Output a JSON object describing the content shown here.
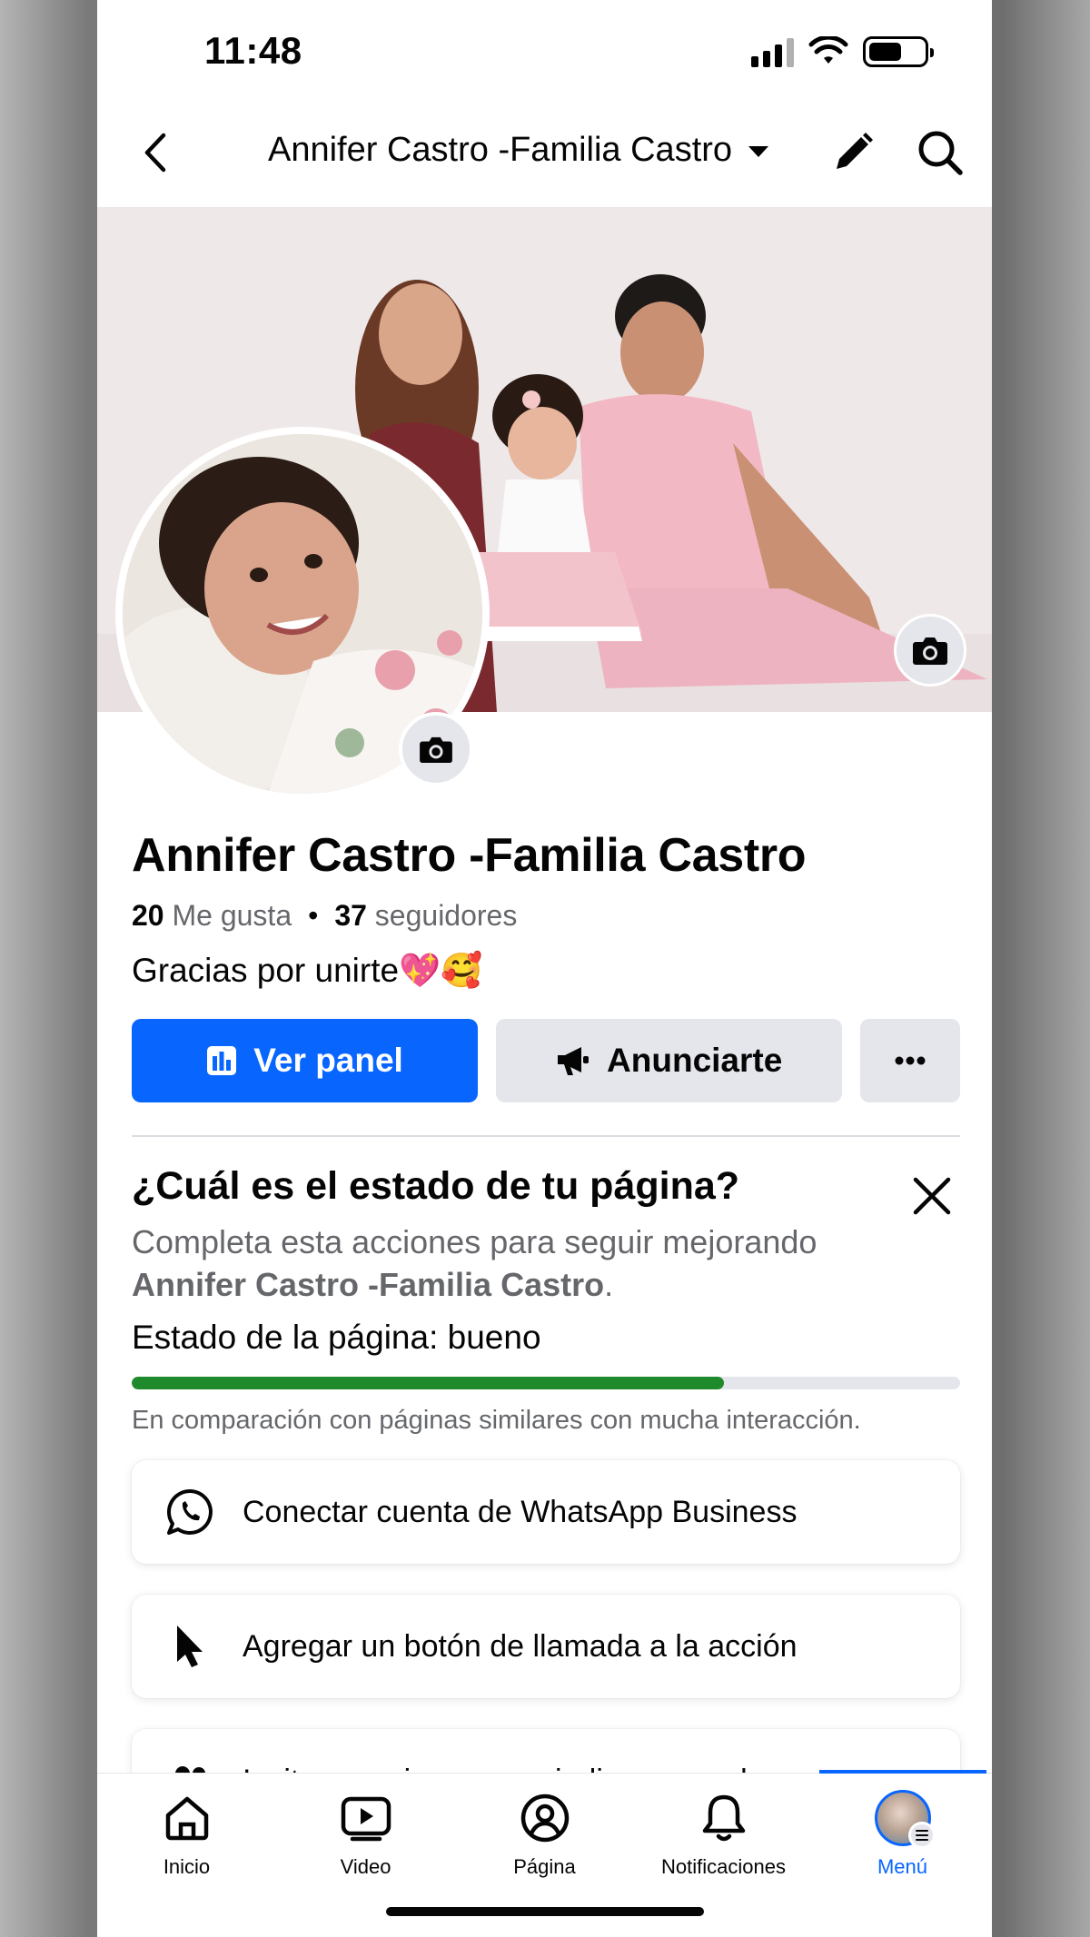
{
  "status_bar": {
    "time": "11:48"
  },
  "header": {
    "title": "Annifer Castro -Familia Castro"
  },
  "profile": {
    "name": "Annifer Castro -Familia Castro",
    "likes_count": "20",
    "likes_label": "Me gusta",
    "followers_count": "37",
    "followers_label": "seguidores",
    "bio": "Gracias por unirte💖🥰"
  },
  "actions": {
    "primary": "Ver panel",
    "secondary": "Anunciarte",
    "more_icon": "ellipsis-icon"
  },
  "health": {
    "title": "¿Cuál es el estado de tu página?",
    "description_prefix": "Completa esta acciones para seguir mejorando",
    "description_name": "Annifer Castro -Familia Castro",
    "description_suffix": ".",
    "status_label": "Estado de la página:",
    "status_value": "bueno",
    "progress": 0.715,
    "comparison": "En comparación con páginas similares con mucha interacción.",
    "tasks": [
      {
        "icon": "whatsapp-icon",
        "label": "Conectar cuenta de WhatsApp Business"
      },
      {
        "icon": "cursor-icon",
        "label": "Agregar un botón de llamada a la acción"
      },
      {
        "icon": "friends-icon",
        "label": "Invitar a amigos a que indiquen que les gusta"
      }
    ]
  },
  "tabbar": {
    "tabs": [
      {
        "icon": "home-icon",
        "label": "Inicio"
      },
      {
        "icon": "video-icon",
        "label": "Video"
      },
      {
        "icon": "page-profile-icon",
        "label": "Página"
      },
      {
        "icon": "bell-icon",
        "label": "Notificaciones"
      },
      {
        "icon": "menu-avatar-icon",
        "label": "Menú"
      }
    ],
    "active": "Menú"
  },
  "colors": {
    "primary": "#0866ff",
    "progress_fill": "#1e8a2b",
    "secondary_bg": "#e4e6eb",
    "muted_text": "#65676b"
  }
}
